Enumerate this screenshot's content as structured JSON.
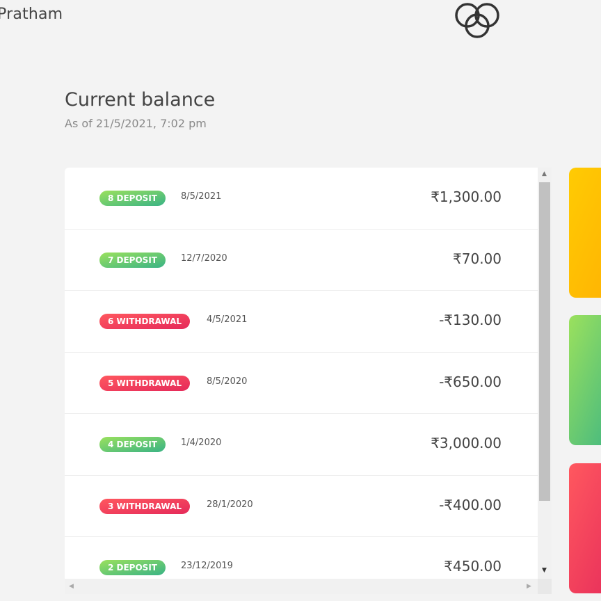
{
  "header": {
    "welcome": "Pratham"
  },
  "balance": {
    "label": "Current balance",
    "date_text": "As of 21/5/2021, 7:02 pm"
  },
  "movements": [
    {
      "type": "deposit",
      "label": "8 DEPOSIT",
      "date": "8/5/2021",
      "value": "₹1,300.00"
    },
    {
      "type": "deposit",
      "label": "7 DEPOSIT",
      "date": "12/7/2020",
      "value": "₹70.00"
    },
    {
      "type": "withdrawal",
      "label": "6 WITHDRAWAL",
      "date": "4/5/2021",
      "value": "-₹130.00"
    },
    {
      "type": "withdrawal",
      "label": "5 WITHDRAWAL",
      "date": "8/5/2020",
      "value": "-₹650.00"
    },
    {
      "type": "deposit",
      "label": "4 DEPOSIT",
      "date": "1/4/2020",
      "value": "₹3,000.00"
    },
    {
      "type": "withdrawal",
      "label": "3 WITHDRAWAL",
      "date": "28/1/2020",
      "value": "-₹400.00"
    },
    {
      "type": "deposit",
      "label": "2 DEPOSIT",
      "date": "23/12/2019",
      "value": "₹450.00"
    }
  ],
  "colors": {
    "deposit_start": "#9be15d",
    "deposit_end": "#39b385",
    "withdrawal_start": "#ff585f",
    "withdrawal_end": "#e52a5a",
    "yellow_card": "#ffcb03",
    "background": "#f3f3f3"
  },
  "icons": {
    "logo": "interlocking-circles-logo",
    "scroll_up": "scroll-up-arrow-icon",
    "scroll_down": "scroll-down-arrow-icon",
    "scroll_left": "scroll-left-arrow-icon",
    "scroll_right": "scroll-right-arrow-icon"
  }
}
